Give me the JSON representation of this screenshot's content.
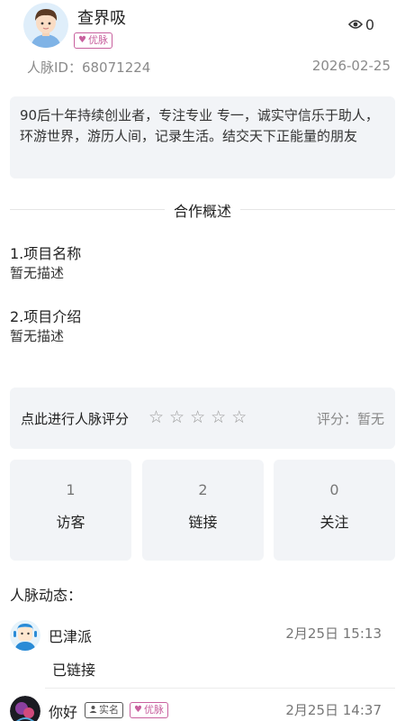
{
  "profile": {
    "name": "查界吸",
    "badge_vip": "优脉",
    "views": "0",
    "id_line": "人脉ID：68071224",
    "date": "2026-02-25",
    "intro": "90后十年持续创业者，专注专业 专一，诚实守信乐于助人，环游世界，游历人间，记录生活。结交天下正能量的朋友"
  },
  "cooperation": {
    "title": "合作概述",
    "item1_label": "1.项目名称",
    "item1_value": "暂无描述",
    "item2_label": "2.项目介绍",
    "item2_value": "暂无描述"
  },
  "rating": {
    "label": "点此进行人脉评分",
    "stars": 0,
    "star_count": 5,
    "score_text": "评分：暂无"
  },
  "stats": [
    {
      "value": "1",
      "label": "访客"
    },
    {
      "value": "2",
      "label": "链接"
    },
    {
      "value": "0",
      "label": "关注"
    }
  ],
  "feed": {
    "title": "人脉动态：",
    "items": [
      {
        "name": "巴津派",
        "time": "2月25日 15:13",
        "text": "已链接"
      },
      {
        "name": "你好",
        "badge_realname": "实名",
        "badge_vip": "优脉",
        "time": "2月25日 14:37"
      }
    ]
  },
  "colors": {
    "accent": "#c8609e",
    "panel_bg": "#f2f4f7",
    "muted_text": "#8a8a8a"
  }
}
